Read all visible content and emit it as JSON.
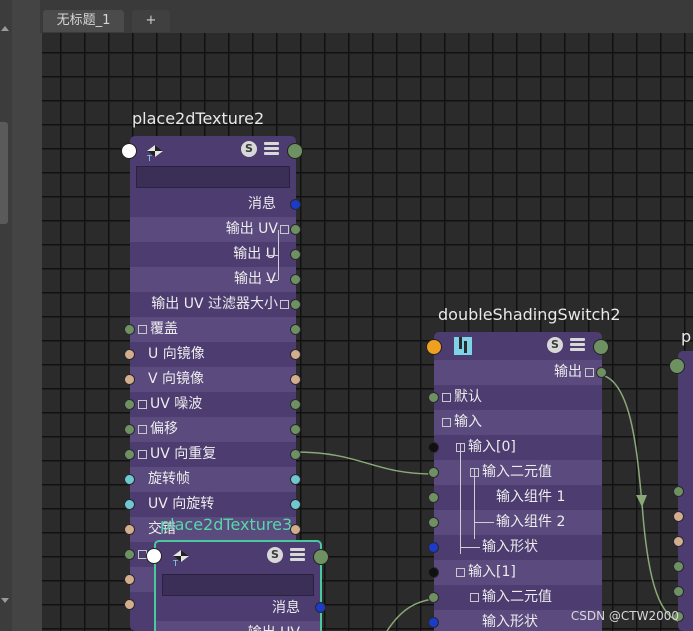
{
  "tabs": {
    "active": "无标题_1",
    "add": "+"
  },
  "node1": {
    "title": "place2dTexture2",
    "s_icon": "S",
    "rows": [
      "消息",
      "输出 UV",
      "输出 U",
      "输出 V",
      "输出 UV 过滤器大小",
      "覆盖",
      "U 向镜像",
      "V 向镜像",
      "UV 噪波",
      "偏移",
      "UV 向重复",
      "旋转帧",
      "UV 向旋转",
      "交错",
      "",
      ""
    ]
  },
  "node2": {
    "title": "doubleShadingSwitch2",
    "s_icon": "S",
    "rows": [
      "输出",
      "默认",
      "输入",
      "输入[0]",
      "输入二元值",
      "输入组件 1",
      "输入组件 2",
      "输入形状",
      "输入[1]",
      "输入二元值",
      "输入形状"
    ]
  },
  "node3": {
    "title": "place2dTexture3",
    "s_icon": "S",
    "rows": [
      "消息",
      "输出 UV"
    ]
  },
  "node4": {
    "title": "p"
  },
  "left_letters": [
    "U",
    "V"
  ],
  "watermark": "CSDN @CTW2000"
}
